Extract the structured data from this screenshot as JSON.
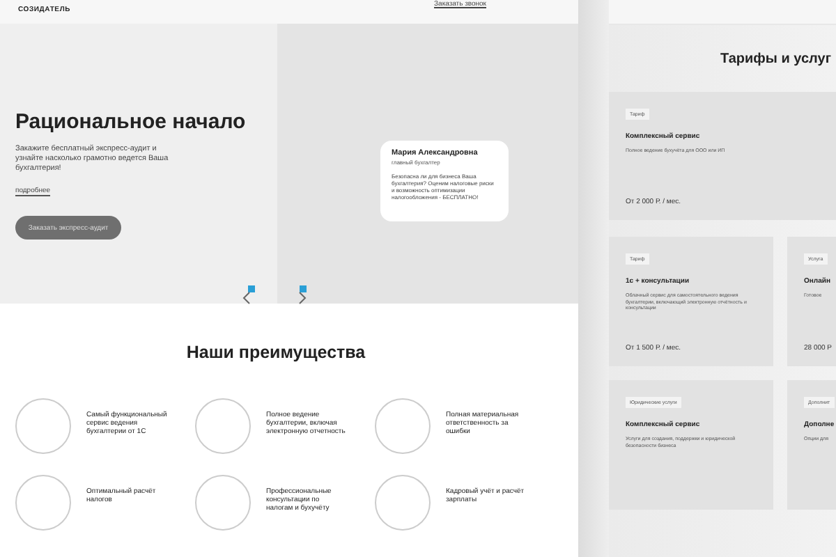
{
  "header": {
    "logo": "СОЗИДАТЕЛЬ",
    "link": "Заказать звонок"
  },
  "hero": {
    "title": "Рациональное начало",
    "description": "Закажите бесплатный экспресс-аудит и узнайте насколько грамотно ведется Ваша бухгалтерия!",
    "more_link": "подробнее",
    "button": "Заказать экспресс-аудит",
    "testimonial": {
      "name": "Мария Александровна",
      "role": "главный бухгалтер",
      "text": "Безопасна ли для бизнеса Ваша бухгалтерия? Оценим налоговые риски и возможность оптимизации налогообложения - БЕСПЛАТНО!"
    }
  },
  "advantages": {
    "title": "Наши преимущества",
    "items": [
      {
        "text": "Самый функциональный сервис ведения бухгалтерии от 1С"
      },
      {
        "text": "Полное ведение бухгалтерии, включая электронную отчетность"
      },
      {
        "text": "Полная материальная ответственность за ошибки"
      },
      {
        "text": "Оптимальный расчёт налогов"
      },
      {
        "text": "Профессиональные консультации по налогам и бухучёту"
      },
      {
        "text": "Кадровый учёт и расчёт зарплаты"
      }
    ]
  },
  "tariffs": {
    "title": "Тарифы и услуг",
    "featured": {
      "tag": "Тариф",
      "title": "Комплексный сервис",
      "description": "Полное ведение бухучёта для ООО или ИП",
      "price": "От 2 000 Р. / мес."
    },
    "cards": [
      {
        "tag": "Тариф",
        "title": "1с + консультации",
        "description": "Облачный сервис для самостоятельного ведения бухгалтерии, включающий электронную отчётность и консультации",
        "price": "От 1 500 Р. / мес."
      },
      {
        "tag": "Услуга",
        "title": "Онлайн",
        "description": "Готовое",
        "price": "28 000 Р"
      },
      {
        "tag": "Юридические услуги",
        "title": "Комплексный сервис",
        "description": "Услуги для создания, поддержки и юридической безопасности бизнеса"
      },
      {
        "tag": "Дополнит",
        "title": "Дополне",
        "description": "Опции для"
      }
    ]
  }
}
